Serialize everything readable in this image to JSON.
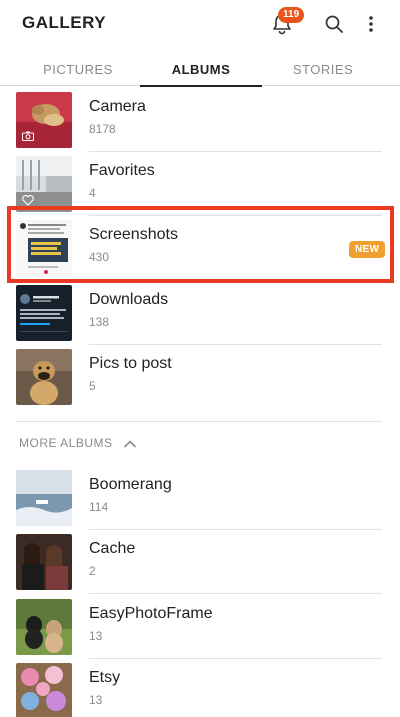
{
  "header": {
    "title": "GALLERY",
    "notification_count": "119",
    "icons": [
      "bell-icon",
      "search-icon",
      "more-vert-icon"
    ]
  },
  "tabs": [
    {
      "label": "PICTURES",
      "active": false
    },
    {
      "label": "ALBUMS",
      "active": true
    },
    {
      "label": "STORIES",
      "active": false
    }
  ],
  "albums": [
    {
      "name": "Camera",
      "count": "8178",
      "overlay_icon": "camera-icon"
    },
    {
      "name": "Favorites",
      "count": "4",
      "overlay_icon": "heart-icon"
    },
    {
      "name": "Screenshots",
      "count": "430",
      "badge": "NEW",
      "highlighted": true
    },
    {
      "name": "Downloads",
      "count": "138"
    },
    {
      "name": "Pics to post",
      "count": "5"
    }
  ],
  "more_albums": {
    "label": "MORE ALBUMS",
    "expanded": true,
    "items": [
      {
        "name": "Boomerang",
        "count": "114"
      },
      {
        "name": "Cache",
        "count": "2"
      },
      {
        "name": "EasyPhotoFrame",
        "count": "13"
      },
      {
        "name": "Etsy",
        "count": "13"
      }
    ]
  },
  "colors": {
    "accent_badge": "#e8541c",
    "new_badge": "#f0a030",
    "highlight_border": "#ea3a24"
  }
}
